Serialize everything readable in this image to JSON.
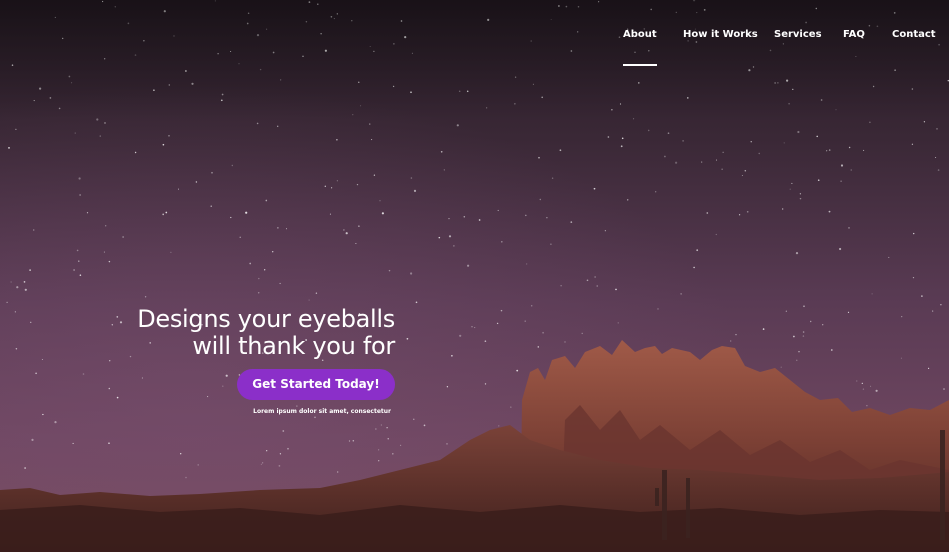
{
  "nav": {
    "items": [
      {
        "label": "About",
        "active": true
      },
      {
        "label": "How it Works",
        "active": false
      },
      {
        "label": "Services",
        "active": false
      },
      {
        "label": "FAQ",
        "active": false
      },
      {
        "label": "Contact",
        "active": false
      }
    ]
  },
  "hero": {
    "headline_line1": "Designs your eyeballs",
    "headline_line2": "will thank you for",
    "cta_label": "Get Started Today!",
    "tagline": "Lorem ipsum dolor sit amet, consectetur"
  },
  "colors": {
    "accent": "#8b2fc9",
    "sky_top": "#2a1f27",
    "sky_mid": "#5c3c55",
    "rock": "#8a4a3a"
  },
  "background_image": "night-sky-desert-mountain"
}
